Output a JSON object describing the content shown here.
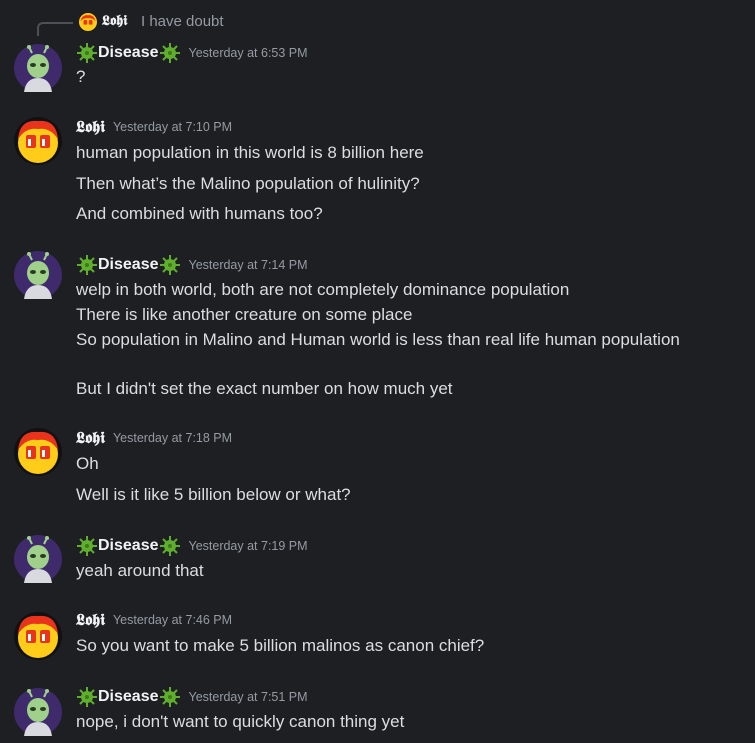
{
  "reply": {
    "author": "𝕷𝖔𝖍𝖎",
    "text": "I have doubt"
  },
  "messages": [
    {
      "author": "Disease",
      "time": "Yesterday at 6:53 PM",
      "lines": [
        "?"
      ]
    },
    {
      "author": "𝕷𝖔𝖍𝖎",
      "time": "Yesterday at 7:10 PM",
      "lines": [
        "human population in this world is 8 billion here",
        "Then what’s the Malino population of hulinity?",
        "And combined with humans too?"
      ]
    },
    {
      "author": "Disease",
      "time": "Yesterday at 7:14 PM",
      "lines": [
        "welp in both world, both are not completely dominance population",
        "There is like another creature on some place",
        "So population in Malino and Human world is less than real life human population",
        "But I didn't set the exact number on how much yet"
      ]
    },
    {
      "author": "𝕷𝖔𝖍𝖎",
      "time": "Yesterday at 7:18 PM",
      "lines": [
        "Oh",
        "Well is it like 5 billion below or what?"
      ]
    },
    {
      "author": "Disease",
      "time": "Yesterday at 7:19 PM",
      "lines": [
        "yeah around that"
      ]
    },
    {
      "author": "𝕷𝖔𝖍𝖎",
      "time": "Yesterday at 7:46 PM",
      "lines": [
        "So you want to make 5 billion malinos as canon chief?"
      ]
    },
    {
      "author": "Disease",
      "time": "Yesterday at 7:51 PM",
      "lines": [
        "nope, i don't want to quickly canon thing yet"
      ]
    }
  ],
  "icons": {
    "disease_avatar": "alien-avatar-icon",
    "lohi_avatar": "fire-face-avatar-icon",
    "name_decoration": "virus-icon"
  },
  "colors": {
    "background": "#1e1f22",
    "text": "#dbdee1",
    "muted": "#949ba4",
    "username": "#f2f3f5",
    "virus": "#5fae2e",
    "disease_avatar_bg": "#3f2a6b"
  }
}
